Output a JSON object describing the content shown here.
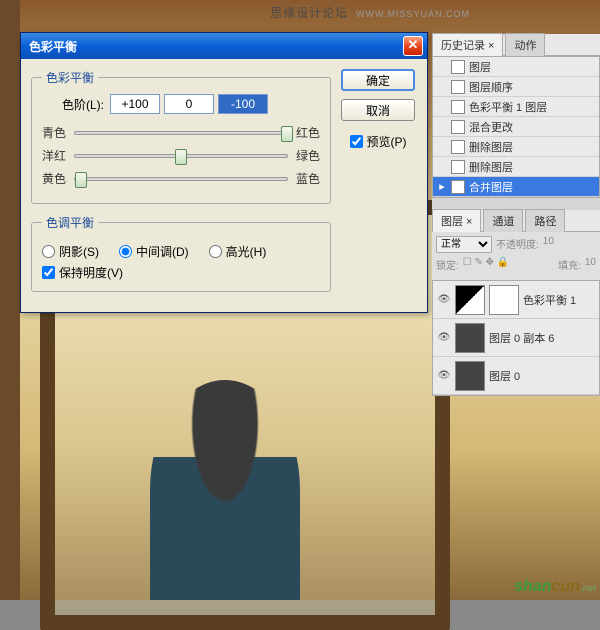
{
  "watermark_top": {
    "cn": "思缘设计论坛",
    "url": "WWW.MISSYUAN.COM"
  },
  "watermark_bottom": {
    "part1": "shan",
    "part2": "cun",
    "suffix": ".net"
  },
  "dialog": {
    "title": "色彩平衡",
    "ok": "确定",
    "cancel": "取消",
    "preview": "预览(P)",
    "color_balance_group": "色彩平衡",
    "levels_label": "色阶(L):",
    "levels": {
      "v1": "+100",
      "v2": "0",
      "v3": "-100"
    },
    "sliders": [
      {
        "left": "青色",
        "right": "红色",
        "pos": 100
      },
      {
        "left": "洋红",
        "right": "绿色",
        "pos": 50
      },
      {
        "left": "黄色",
        "right": "蓝色",
        "pos": 3
      }
    ],
    "tone_balance_group": "色调平衡",
    "tone": {
      "shadows": "阴影(S)",
      "midtones": "中间调(D)",
      "highlights": "高光(H)"
    },
    "preserve_lum": "保持明度(V)"
  },
  "history": {
    "tab1": "历史记录",
    "tab2": "动作",
    "items": [
      "图层",
      "图层顺序",
      "色彩平衡 1 图层",
      "混合更改",
      "删除图层",
      "删除图层",
      "合并图层"
    ],
    "selected_index": 6
  },
  "layers": {
    "tab1": "图层",
    "tab2": "通道",
    "tab3": "路径",
    "blend_mode": "正常",
    "opacity_label": "不透明度:",
    "opacity_val": "10",
    "lock_label": "锁定:",
    "fill_label": "填充:",
    "fill_val": "10",
    "items": [
      {
        "name": "色彩平衡 1",
        "type": "adj"
      },
      {
        "name": "图层 0 副本 6",
        "type": "img"
      },
      {
        "name": "图层 0",
        "type": "img"
      }
    ]
  }
}
